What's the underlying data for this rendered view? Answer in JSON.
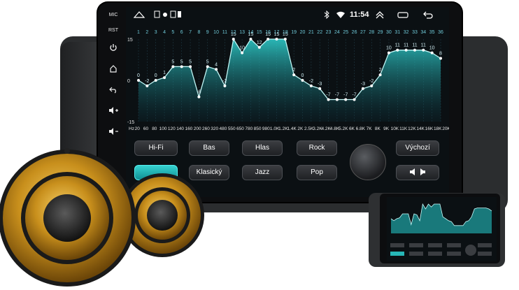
{
  "status": {
    "time": "11:54",
    "mic_label": "MIC",
    "rst_label": "RST"
  },
  "eq": {
    "band_numbers": [
      "1",
      "2",
      "3",
      "4",
      "5",
      "6",
      "7",
      "8",
      "9",
      "10",
      "11",
      "12",
      "13",
      "14",
      "15",
      "16",
      "17",
      "18",
      "19",
      "20",
      "21",
      "22",
      "23",
      "24",
      "25",
      "26",
      "27",
      "28",
      "29",
      "30",
      "31",
      "32",
      "33",
      "34",
      "35",
      "36"
    ],
    "y_labels": [
      "15",
      "0",
      "-15"
    ],
    "freq_labels": [
      "Hz",
      "20",
      "60",
      "80",
      "100",
      "120",
      "140",
      "160",
      "200",
      "260",
      "320",
      "480",
      "550",
      "650",
      "780",
      "850",
      "980",
      "1.0K",
      "1.2K",
      "1.4K",
      "2K",
      "2.5K",
      "3.2K",
      "4.2K",
      "4.8K",
      "5.2K",
      "6K",
      "6.8K",
      "7K",
      "8K",
      "9K",
      "10K",
      "11K",
      "12K",
      "14K",
      "16K",
      "18K",
      "20K"
    ],
    "values": [
      0,
      -2,
      0,
      1,
      5,
      5,
      5,
      -6,
      5,
      4,
      -2,
      15,
      10,
      15,
      12,
      15,
      15,
      15,
      2,
      0,
      -2,
      -3,
      -7,
      -7,
      -7,
      -7,
      -3,
      -2,
      2,
      10,
      11,
      11,
      11,
      11,
      10,
      8
    ],
    "accent": "#2fd3d1"
  },
  "buttons": {
    "hifi": "Hi-Fi",
    "bas": "Bas",
    "hlas": "Hlas",
    "rock": "Rock",
    "vychozi": "Výchozí",
    "klasicky": "Klasický",
    "jazz": "Jazz",
    "pop": "Pop"
  },
  "icons": {
    "power": "power-icon",
    "home": "home-icon",
    "back": "back-icon",
    "volup": "volume-up-icon",
    "voldown": "volume-down-icon",
    "balance": "balance-icon"
  }
}
